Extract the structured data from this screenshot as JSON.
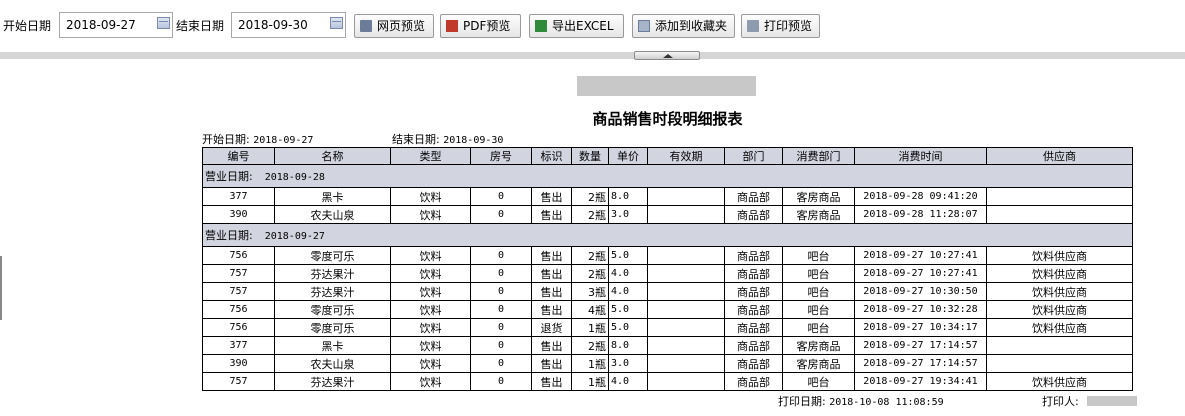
{
  "toolbar": {
    "start_label": "开始日期",
    "start_value": "2018-09-27",
    "end_label": "结束日期",
    "end_value": "2018-09-30",
    "buttons": {
      "web_preview": "网页预览",
      "pdf_preview": "PDF预览",
      "export_excel": "导出EXCEL",
      "add_favorite": "添加到收藏夹",
      "print_preview": "打印预览"
    }
  },
  "report": {
    "title": "商品销售时段明细报表",
    "start_label": "开始日期:",
    "start_value": "2018-09-27",
    "end_label": "结束日期:",
    "end_value": "2018-09-30",
    "columns": [
      "编号",
      "名称",
      "类型",
      "房号",
      "标识",
      "数量",
      "单价",
      "有效期",
      "部门",
      "消费部门",
      "消费时间",
      "供应商"
    ],
    "groups": [
      {
        "label": "营业日期:",
        "date": "2018-09-28",
        "rows": [
          {
            "id": "377",
            "name": "黑卡",
            "type": "饮料",
            "room": "0",
            "flag": "售出",
            "qty": "2瓶",
            "price": "8.0",
            "expiry": "",
            "dept": "商品部",
            "cons_dept": "客房商品",
            "time": "2018-09-28 09:41:20",
            "supplier": ""
          },
          {
            "id": "390",
            "name": "农夫山泉",
            "type": "饮料",
            "room": "0",
            "flag": "售出",
            "qty": "2瓶",
            "price": "3.0",
            "expiry": "",
            "dept": "商品部",
            "cons_dept": "客房商品",
            "time": "2018-09-28 11:28:07",
            "supplier": ""
          }
        ]
      },
      {
        "label": "营业日期:",
        "date": "2018-09-27",
        "rows": [
          {
            "id": "756",
            "name": "零度可乐",
            "type": "饮料",
            "room": "0",
            "flag": "售出",
            "qty": "2瓶",
            "price": "5.0",
            "expiry": "",
            "dept": "商品部",
            "cons_dept": "吧台",
            "time": "2018-09-27 10:27:41",
            "supplier": "饮料供应商"
          },
          {
            "id": "757",
            "name": "芬达果汁",
            "type": "饮料",
            "room": "0",
            "flag": "售出",
            "qty": "2瓶",
            "price": "4.0",
            "expiry": "",
            "dept": "商品部",
            "cons_dept": "吧台",
            "time": "2018-09-27 10:27:41",
            "supplier": "饮料供应商"
          },
          {
            "id": "757",
            "name": "芬达果汁",
            "type": "饮料",
            "room": "0",
            "flag": "售出",
            "qty": "3瓶",
            "price": "4.0",
            "expiry": "",
            "dept": "商品部",
            "cons_dept": "吧台",
            "time": "2018-09-27 10:30:50",
            "supplier": "饮料供应商"
          },
          {
            "id": "756",
            "name": "零度可乐",
            "type": "饮料",
            "room": "0",
            "flag": "售出",
            "qty": "4瓶",
            "price": "5.0",
            "expiry": "",
            "dept": "商品部",
            "cons_dept": "吧台",
            "time": "2018-09-27 10:32:28",
            "supplier": "饮料供应商"
          },
          {
            "id": "756",
            "name": "零度可乐",
            "type": "饮料",
            "room": "0",
            "flag": "退货",
            "qty": "1瓶",
            "price": "5.0",
            "expiry": "",
            "dept": "商品部",
            "cons_dept": "吧台",
            "time": "2018-09-27 10:34:17",
            "supplier": "饮料供应商"
          },
          {
            "id": "377",
            "name": "黑卡",
            "type": "饮料",
            "room": "0",
            "flag": "售出",
            "qty": "2瓶",
            "price": "8.0",
            "expiry": "",
            "dept": "商品部",
            "cons_dept": "客房商品",
            "time": "2018-09-27 17:14:57",
            "supplier": ""
          },
          {
            "id": "390",
            "name": "农夫山泉",
            "type": "饮料",
            "room": "0",
            "flag": "售出",
            "qty": "1瓶",
            "price": "3.0",
            "expiry": "",
            "dept": "商品部",
            "cons_dept": "客房商品",
            "time": "2018-09-27 17:14:57",
            "supplier": ""
          },
          {
            "id": "757",
            "name": "芬达果汁",
            "type": "饮料",
            "room": "0",
            "flag": "售出",
            "qty": "1瓶",
            "price": "4.0",
            "expiry": "",
            "dept": "商品部",
            "cons_dept": "吧台",
            "time": "2018-09-27 19:34:41",
            "supplier": "饮料供应商"
          }
        ]
      }
    ],
    "footer": {
      "print_date_label": "打印日期:",
      "print_date_value": "2018-10-08 11:08:59",
      "printer_label": "打印人:"
    }
  }
}
